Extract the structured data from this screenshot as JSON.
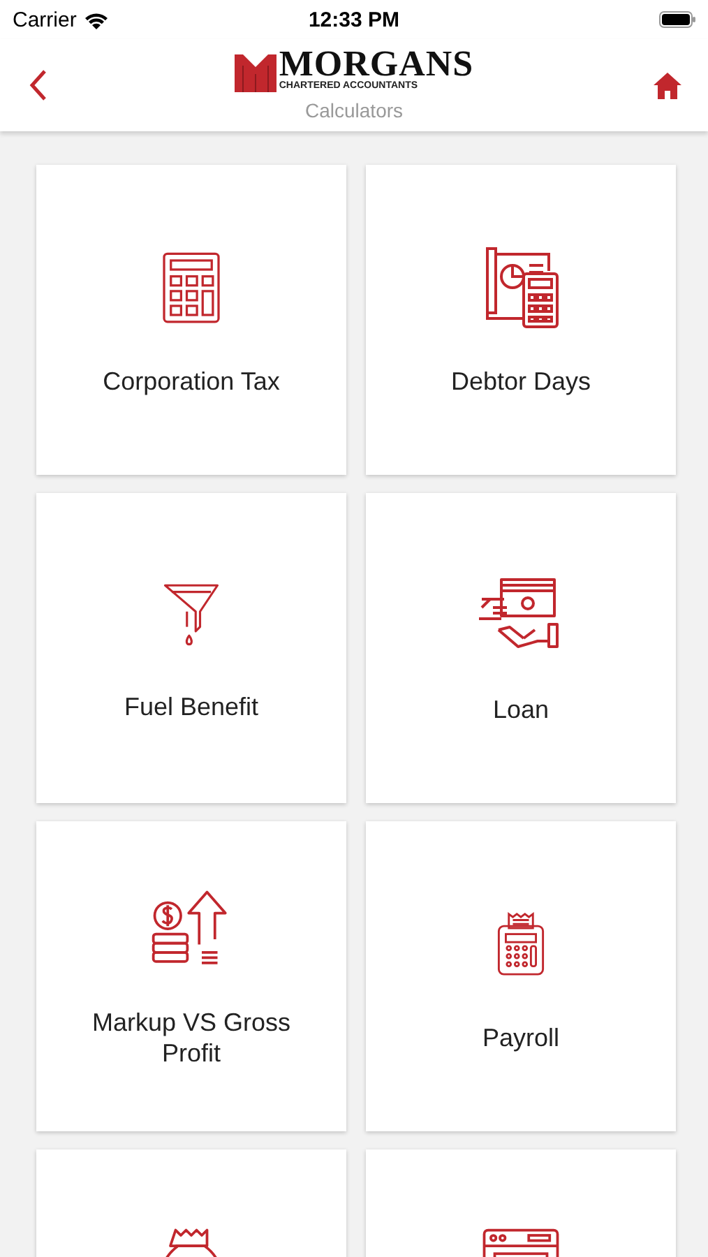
{
  "status_bar": {
    "carrier": "Carrier",
    "time": "12:33 PM"
  },
  "header": {
    "logo_name": "MORGANS",
    "logo_tagline": "CHARTERED ACCOUNTANTS",
    "title": "Calculators"
  },
  "calculators": [
    {
      "kind": "calculator",
      "label": "Corporation Tax"
    },
    {
      "kind": "report",
      "label": "Debtor Days"
    },
    {
      "kind": "funnel",
      "label": "Fuel Benefit"
    },
    {
      "kind": "cash",
      "label": "Loan"
    },
    {
      "kind": "growth",
      "label": "Markup VS Gross Profit"
    },
    {
      "kind": "terminal",
      "label": "Payroll"
    },
    {
      "kind": "bag"
    },
    {
      "kind": "browser"
    }
  ]
}
